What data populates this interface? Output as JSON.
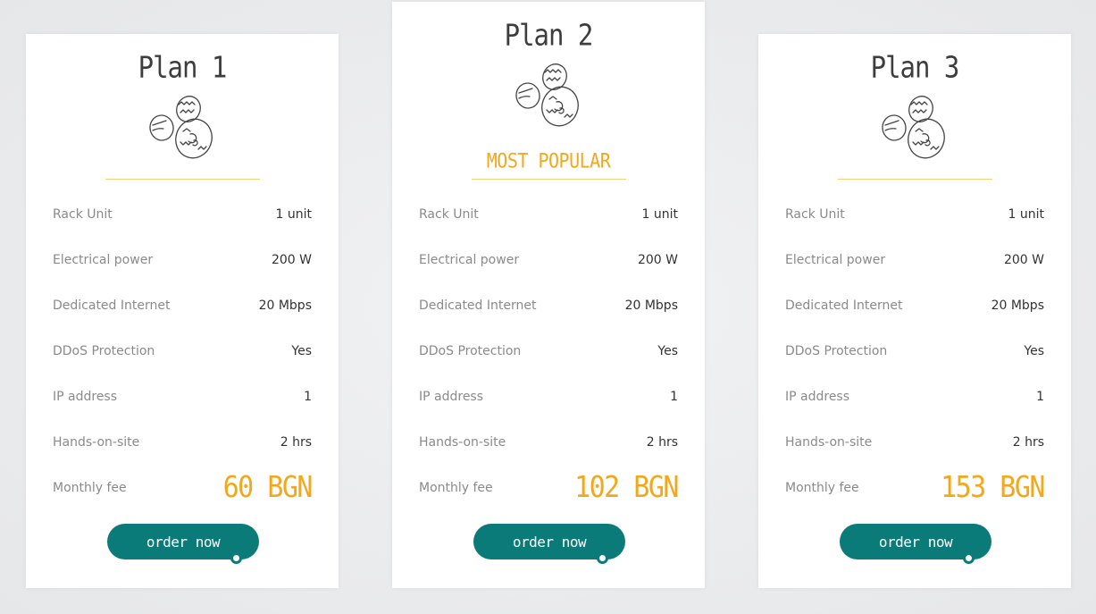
{
  "colors": {
    "accent": "#f2a81d",
    "button": "#0b7b7a"
  },
  "plans": [
    {
      "title": "Plan 1",
      "icon": "eggs-icon",
      "popular": "",
      "features": [
        {
          "label": "Rack Unit",
          "value": "1 unit"
        },
        {
          "label": "Electrical power",
          "value": "200 W"
        },
        {
          "label": "Dedicated Internet",
          "value": "20 Mbps"
        },
        {
          "label": "DDoS Protection",
          "value": "Yes"
        },
        {
          "label": "IP address",
          "value": "1"
        },
        {
          "label": "Hands-on-site",
          "value": "2 hrs"
        },
        {
          "label": "Monthly fee",
          "value": "60 BGN"
        }
      ],
      "button": "order now"
    },
    {
      "title": "Plan 2",
      "icon": "eggs-icon",
      "popular": "MOST POPULAR",
      "features": [
        {
          "label": "Rack Unit",
          "value": "1 unit"
        },
        {
          "label": "Electrical power",
          "value": "200 W"
        },
        {
          "label": "Dedicated Internet",
          "value": "20 Mbps"
        },
        {
          "label": "DDoS Protection",
          "value": "Yes"
        },
        {
          "label": "IP address",
          "value": "1"
        },
        {
          "label": "Hands-on-site",
          "value": "2 hrs"
        },
        {
          "label": "Monthly fee",
          "value": "102 BGN"
        }
      ],
      "button": "order now"
    },
    {
      "title": "Plan 3",
      "icon": "eggs-icon",
      "popular": "",
      "features": [
        {
          "label": "Rack Unit",
          "value": "1 unit"
        },
        {
          "label": "Electrical power",
          "value": "200 W"
        },
        {
          "label": "Dedicated Internet",
          "value": "20 Mbps"
        },
        {
          "label": "DDoS Protection",
          "value": "Yes"
        },
        {
          "label": "IP address",
          "value": "1"
        },
        {
          "label": "Hands-on-site",
          "value": "2 hrs"
        },
        {
          "label": "Monthly fee",
          "value": "153 BGN"
        }
      ],
      "button": "order now"
    }
  ]
}
